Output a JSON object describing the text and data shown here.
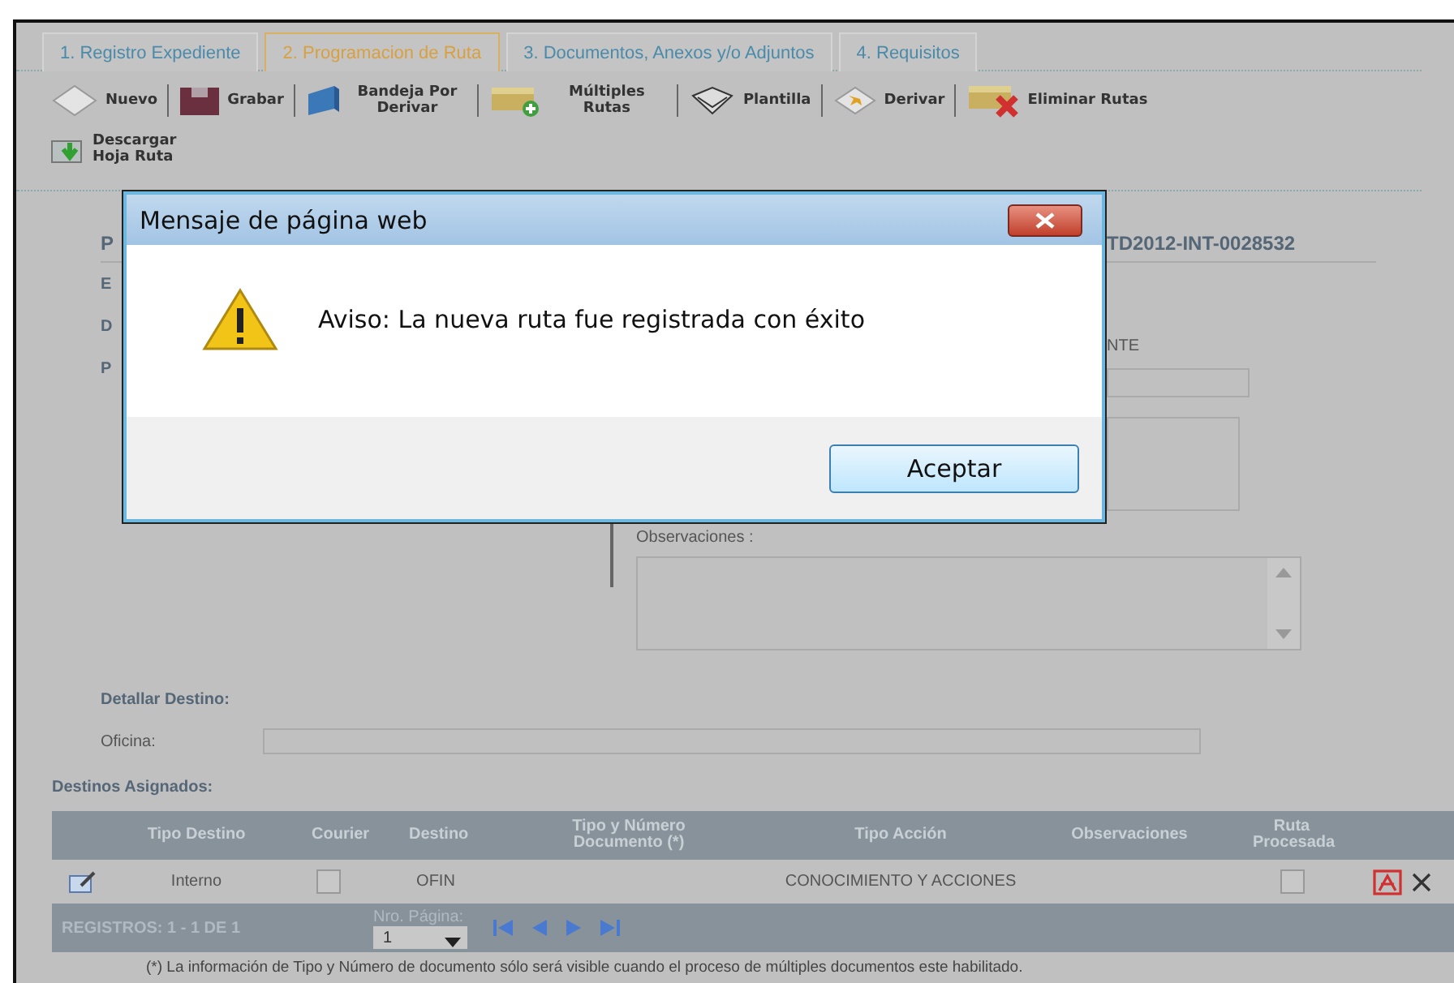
{
  "tabs": [
    {
      "label": "1. Registro Expediente",
      "selected": false
    },
    {
      "label": "2. Programacion de Ruta",
      "selected": true
    },
    {
      "label": "3. Documentos, Anexos y/o Adjuntos",
      "selected": false
    },
    {
      "label": "4. Requisitos",
      "selected": false
    }
  ],
  "toolbar": [
    {
      "label": "Nuevo"
    },
    {
      "label": "Grabar"
    },
    {
      "label": "Bandeja Por Derivar"
    },
    {
      "label": "Múltiples Rutas"
    },
    {
      "label": "Plantilla"
    },
    {
      "label": "Derivar"
    },
    {
      "label": "Eliminar Rutas"
    },
    {
      "label": "Descargar Hoja Ruta"
    }
  ],
  "form": {
    "heading_left": "P",
    "heading_right": "TD2012-INT-0028532",
    "labels": [
      "E",
      "D",
      "P"
    ],
    "value_right": "NTE",
    "observaciones_label": "Observaciones :",
    "detail_heading": "Detallar Destino:",
    "office_label": "Oficina:",
    "assigned_heading": "Destinos Asignados:"
  },
  "table": {
    "columns": [
      "Tipo Destino",
      "Courier",
      "Destino",
      "Tipo y Número Documento (*)",
      "Tipo Acción",
      "Observaciones",
      "Ruta Procesada"
    ],
    "rows": [
      {
        "tipo_destino": "Interno",
        "courier_checked": false,
        "destino": "OFIN",
        "tipo_accion": "CONOCIMIENTO Y ACCIONES",
        "ruta_procesada_checked": false
      }
    ],
    "pager": {
      "records": "REGISTROS: 1 - 1 DE 1",
      "page_label": "Nro. Página:",
      "page_value": "1"
    }
  },
  "footnote": "(*) La información de Tipo y Número de documento sólo será visible cuando el proceso de múltiples documentos este habilitado.",
  "dialog": {
    "title": "Mensaje de página web",
    "message": "Aviso: La nueva ruta fue registrada con éxito",
    "button": "Aceptar"
  }
}
